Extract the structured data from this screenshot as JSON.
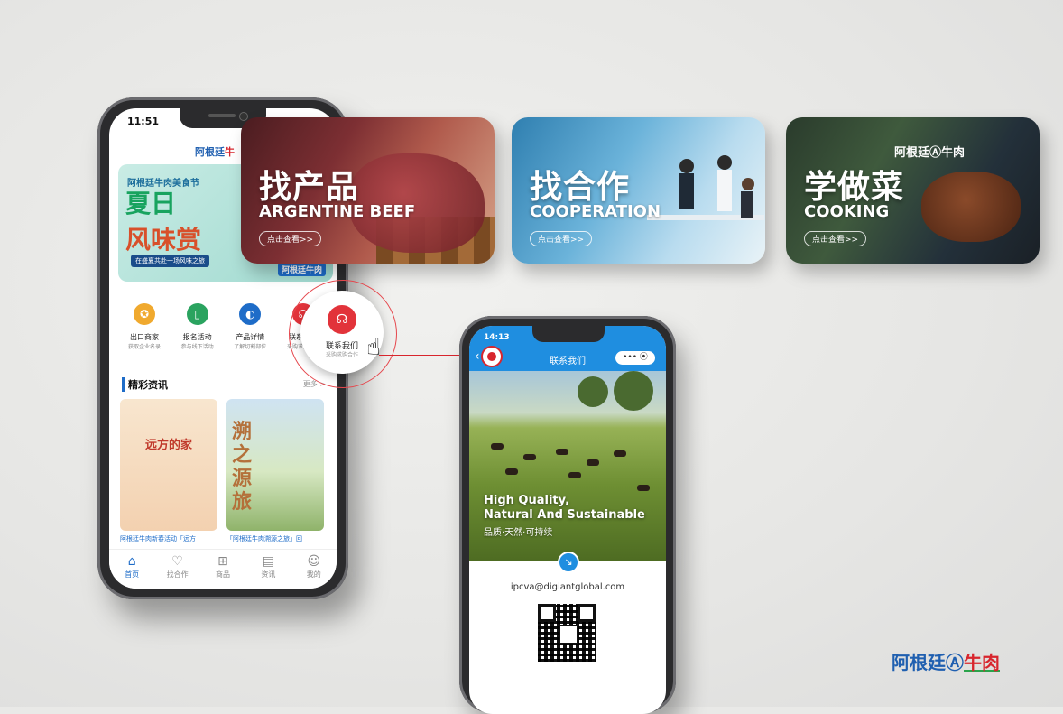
{
  "left_phone": {
    "time": "11:51",
    "brand": "阿根廷",
    "brand_accent": "牛",
    "banner": {
      "subtitle": "阿根廷牛肉美食节",
      "title_line1": "夏日",
      "title_line2": "风味赏",
      "tag": "在盛夏共赴一场风味之旅",
      "logo": "阿根廷牛肉"
    },
    "grid": [
      {
        "label": "出口商家",
        "sub": "获取企业名录",
        "icon": "store-icon",
        "color": "#f0a92e"
      },
      {
        "label": "报名活动",
        "sub": "参与线下活动",
        "icon": "signup-icon",
        "color": "#2aa35f"
      },
      {
        "label": "产品详情",
        "sub": "了解切割部位",
        "icon": "product-icon",
        "color": "#1e6cc8"
      },
      {
        "label": "联系我们",
        "sub": "采购求购合作",
        "icon": "contact-icon",
        "color": "#e2333a"
      }
    ],
    "section_title": "精彩资讯",
    "more": "更多 >",
    "cards": [
      {
        "title": "远方的家",
        "caption": "阿根廷牛肉新春活动「远方"
      },
      {
        "title": "溯之源旅",
        "caption": "「阿根廷牛肉溯源之旅」回"
      }
    ],
    "tabs": [
      {
        "label": "首页",
        "icon": "home-icon",
        "glyph": "⌂"
      },
      {
        "label": "找合作",
        "icon": "handshake-icon",
        "glyph": "♡"
      },
      {
        "label": "商品",
        "icon": "basket-icon",
        "glyph": "⊞"
      },
      {
        "label": "资讯",
        "icon": "news-icon",
        "glyph": "▤"
      },
      {
        "label": "我的",
        "icon": "user-icon",
        "glyph": "☺"
      }
    ]
  },
  "feature_cards": [
    {
      "zh": "找产品",
      "en": "ARGENTINE BEEF",
      "button": "点击查看>>"
    },
    {
      "zh": "找合作",
      "en": "COOPERATION",
      "button": "点击查看>>"
    },
    {
      "zh": "学做菜",
      "en": "COOKING",
      "button": "点击查看>>"
    }
  ],
  "callout": {
    "label": "联系我们",
    "sub": "采购求购合作"
  },
  "right_phone": {
    "time": "14:13",
    "title": "联系我们",
    "pill": "•••  ⦿",
    "headline_line1": "High Quality,",
    "headline_line2": "Natural And Sustainable",
    "headline_zh": "品质·天然·可持续",
    "email": "ipcva@digiantglobal.com"
  },
  "bottom_logo": {
    "main": "阿根廷",
    "accent": "牛肉",
    "mark": "Ⓐ"
  },
  "colors": {
    "brand_blue": "#1f5fb0",
    "brand_red": "#d8252d",
    "accent_green": "#2aa34a",
    "header_blue": "#1f8ee0"
  }
}
